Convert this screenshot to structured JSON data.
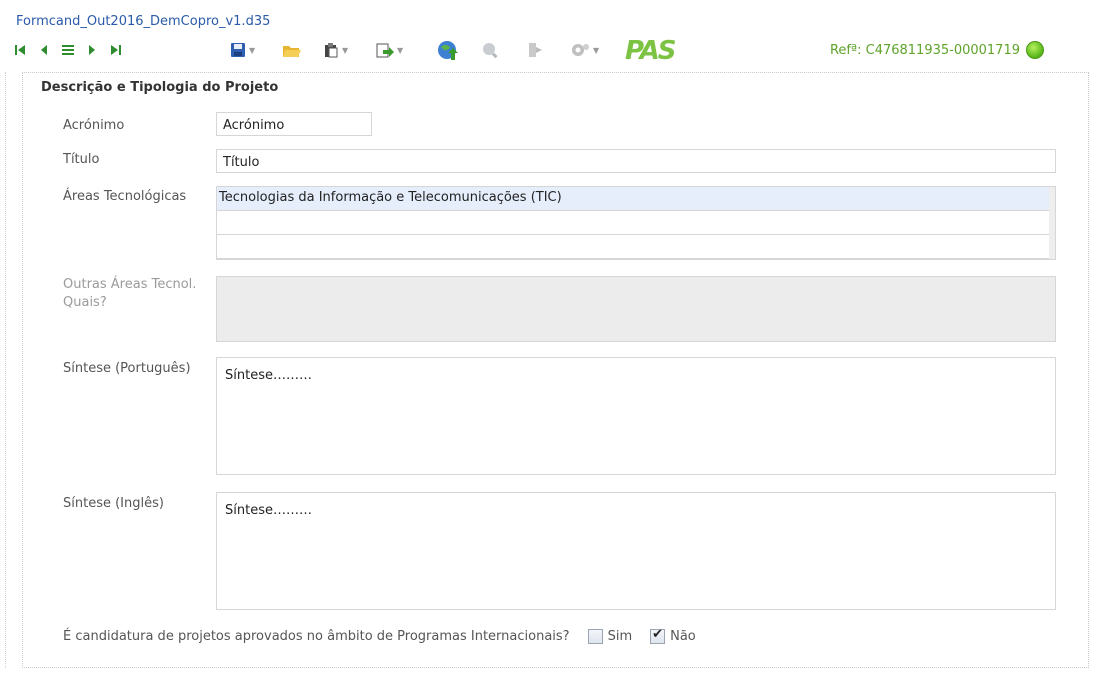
{
  "file_title": "Formcand_Out2016_DemCopro_v1.d35",
  "toolbar": {
    "icons": [
      "first-icon",
      "prev-icon",
      "list-icon",
      "next-icon",
      "last-icon",
      "save-icon",
      "open-icon",
      "paste-icon",
      "export-icon",
      "globe-upload-icon",
      "search-icon",
      "exit-icon",
      "settings-icon"
    ],
    "logo": "PAS",
    "ref": "Refª: C476811935-00001719"
  },
  "section": {
    "title": "Descrição e Tipologia do Projeto",
    "acronimo_label": "Acrónimo",
    "acronimo_value": "Acrónimo",
    "titulo_label": "Título",
    "titulo_value": "Título",
    "areas_label": "Áreas Tecnológicas",
    "areas_items": [
      "Tecnologias da Informação e Telecomunicações (TIC)",
      "",
      ""
    ],
    "outras_label_1": "Outras Áreas Tecnol.",
    "outras_label_2": "Quais?",
    "sintese_pt_label": "Síntese (Português)",
    "sintese_pt_value": "Síntese………",
    "sintese_en_label": "Síntese (Inglês)",
    "sintese_en_value": "Síntese………",
    "question": "É candidatura de projetos aprovados no âmbito de Programas Internacionais?",
    "opt_sim": "Sim",
    "opt_nao": "Não",
    "opt_sim_checked": false,
    "opt_nao_checked": true
  },
  "colors": {
    "accent": "#2a5aa8",
    "ref_green": "#5fa32a",
    "logo_green": "#7cc243"
  }
}
